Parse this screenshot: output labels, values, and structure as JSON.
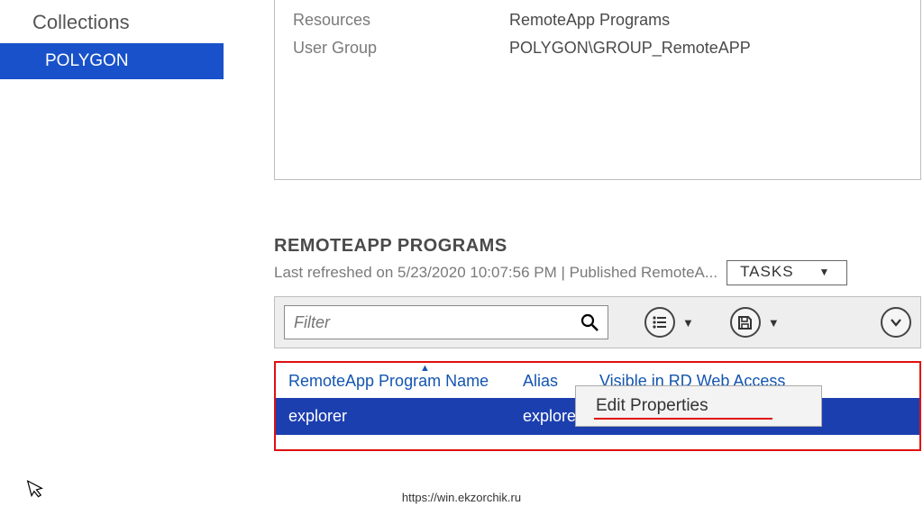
{
  "sidebar": {
    "header": "Collections",
    "items": [
      {
        "label": "POLYGON"
      }
    ]
  },
  "info": {
    "rows": [
      {
        "label": "Resources",
        "value": "RemoteApp Programs"
      },
      {
        "label": "User Group",
        "value": "POLYGON\\GROUP_RemoteAPP"
      }
    ]
  },
  "section": {
    "title": "REMOTEAPP PROGRAMS",
    "subtext": "Last refreshed on 5/23/2020 10:07:56 PM | Published RemoteA...",
    "tasks_label": "TASKS"
  },
  "filter": {
    "placeholder": "Filter"
  },
  "table": {
    "cols": {
      "c1": "RemoteApp Program Name",
      "c2": "Alias",
      "c3": "Visible in RD Web Access"
    },
    "row": {
      "name": "explorer",
      "alias": "explore"
    }
  },
  "context_menu": {
    "item": "Edit Properties"
  },
  "footer_url": "https://win.ekzorchik.ru"
}
